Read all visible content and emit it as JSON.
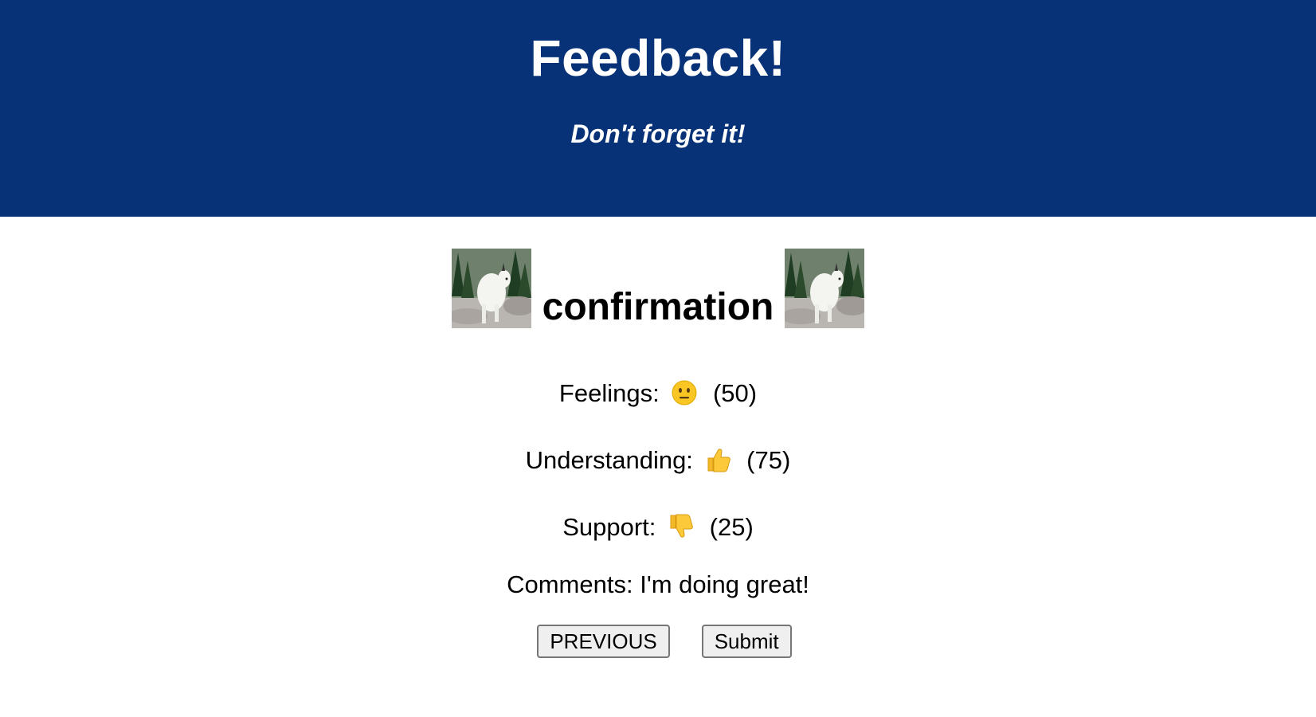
{
  "header": {
    "title": "Feedback!",
    "subtitle": "Don't forget it!",
    "background_color": "#083277"
  },
  "main": {
    "title": "confirmation",
    "images": [
      "goat-photo",
      "goat-photo"
    ],
    "ratings": [
      {
        "label": "Feelings:",
        "icon": "neutral-face-icon",
        "value": "(50)"
      },
      {
        "label": "Understanding:",
        "icon": "thumbs-up-icon",
        "value": "(75)"
      },
      {
        "label": "Support:",
        "icon": "thumbs-down-icon",
        "value": "(25)"
      }
    ],
    "comments_label": "Comments:",
    "comments_value": "I'm doing great!"
  },
  "buttons": {
    "previous_label": "PREVIOUS",
    "submit_label": "Submit"
  }
}
